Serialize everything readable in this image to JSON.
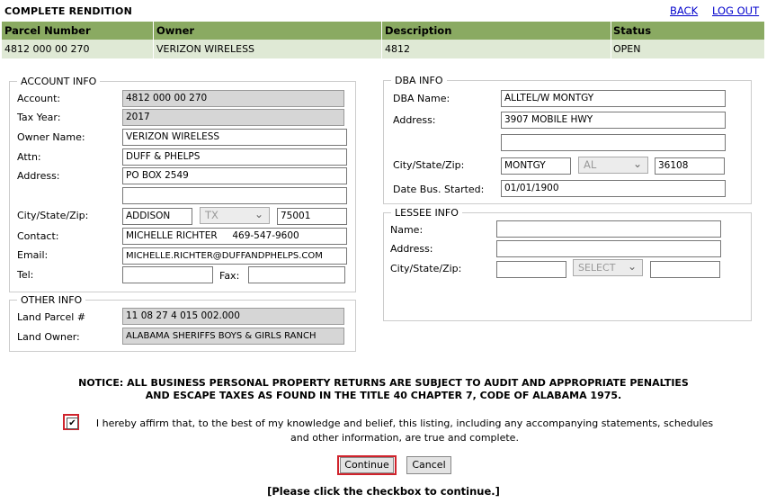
{
  "header": {
    "title": "COMPLETE RENDITION",
    "back": "BACK",
    "logout": "LOG OUT"
  },
  "grid": {
    "columns": [
      "Parcel Number",
      "Owner",
      "Description",
      "Status"
    ],
    "row": [
      "4812 000 00 270",
      "VERIZON WIRELESS",
      "4812",
      "OPEN"
    ]
  },
  "account": {
    "legend": "ACCOUNT INFO",
    "account_label": "Account:",
    "account": "4812 000 00 270",
    "taxyear_label": "Tax Year:",
    "taxyear": "2017",
    "owner_label": "Owner Name:",
    "owner": "VERIZON WIRELESS",
    "attn_label": "Attn:",
    "attn": "DUFF & PHELPS",
    "address_label": "Address:",
    "address1": "PO BOX 2549",
    "address2": "",
    "csz_label": "City/State/Zip:",
    "city": "ADDISON",
    "state": "TX",
    "zip": "75001",
    "contact_label": "Contact:",
    "contact": "MICHELLE RICHTER     469-547-9600",
    "email_label": "Email:",
    "email": "MICHELLE.RICHTER@DUFFANDPHELPS.COM",
    "tel_label": "Tel:",
    "tel": "",
    "fax_label": "Fax:",
    "fax": ""
  },
  "other": {
    "legend": "OTHER INFO",
    "parcel_label": "Land Parcel #",
    "parcel": "11 08 27 4 015 002.000",
    "owner_label": "Land Owner:",
    "owner": "ALABAMA SHERIFFS BOYS & GIRLS RANCH"
  },
  "dba": {
    "legend": "DBA INFO",
    "name_label": "DBA Name:",
    "name": "ALLTEL/W MONTGY",
    "address_label": "Address:",
    "address1": "3907 MOBILE HWY",
    "address2": "",
    "csz_label": "City/State/Zip:",
    "city": "MONTGY",
    "state": "AL",
    "zip": "36108",
    "started_label": "Date Bus. Started:",
    "started": "01/01/1900"
  },
  "lessee": {
    "legend": "LESSEE INFO",
    "name_label": "Name:",
    "name": "",
    "address_label": "Address:",
    "address": "",
    "csz_label": "City/State/Zip:",
    "city": "",
    "state": "SELECT",
    "zip": ""
  },
  "notice": {
    "line1": "NOTICE: ALL BUSINESS PERSONAL PROPERTY RETURNS ARE SUBJECT TO AUDIT AND APPROPRIATE PENALTIES",
    "line2": "AND ESCAPE TAXES AS FOUND IN THE TITLE 40 CHAPTER 7, CODE OF ALABAMA 1975."
  },
  "affirm": {
    "checked_mark": "✔",
    "line1": "I hereby affirm that, to the best of my knowledge and belief, this listing, including any accompanying statements, schedules",
    "line2": "and other information, are true and complete."
  },
  "buttons": {
    "continue": "Continue",
    "cancel": "Cancel"
  },
  "hint": "[Please click the checkbox to continue.]"
}
